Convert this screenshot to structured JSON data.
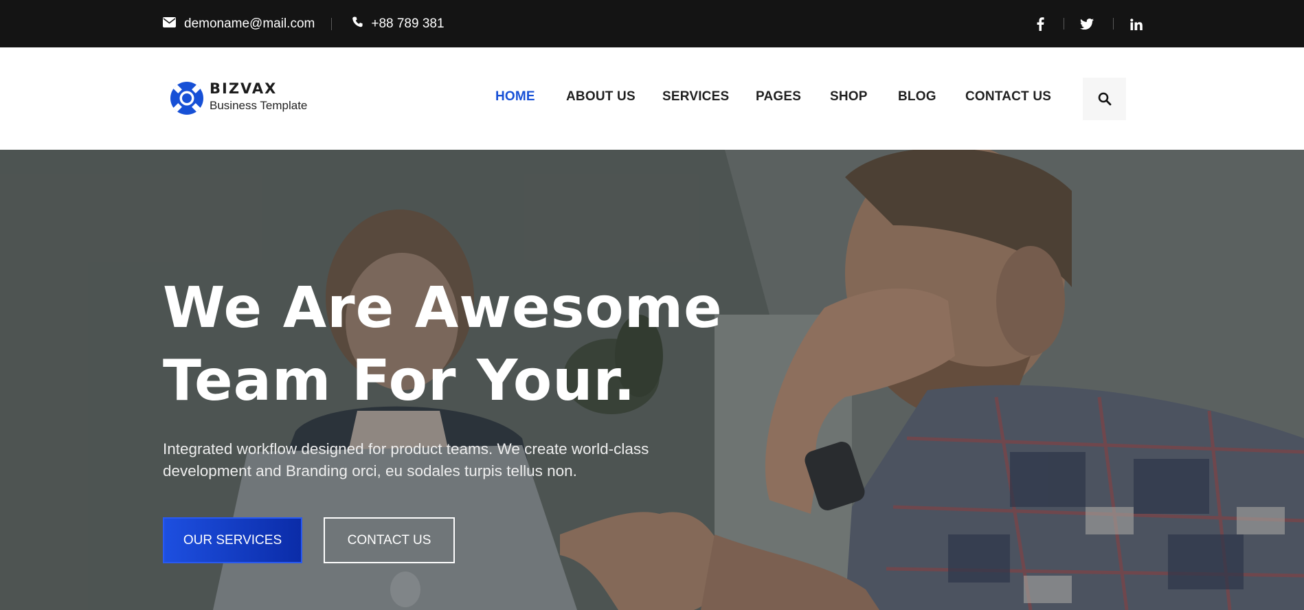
{
  "topbar": {
    "email": "demoname@mail.com",
    "phone": "+88 789 381",
    "email_icon": "envelope-icon",
    "phone_icon": "phone-icon",
    "social": [
      "facebook-icon",
      "twitter-icon",
      "linkedin-icon"
    ]
  },
  "header": {
    "logo_name": "BIZVAX",
    "logo_tagline": "Business Template",
    "nav": [
      "HOME",
      "ABOUT US",
      "SERVICES",
      "PAGES",
      "SHOP",
      "BLOG",
      "CONTACT US"
    ],
    "active_nav": "HOME",
    "search_icon": "search-icon"
  },
  "hero": {
    "title_line1": "We Are Awesome",
    "title_line2": "Team For Your.",
    "subtitle": "Integrated workflow designed for product teams. We create world-class development and Branding orci, eu sodales turpis tellus non.",
    "primary_button": "OUR SERVICES",
    "secondary_button": "CONTACT US"
  },
  "colors": {
    "accent": "#1750d6",
    "topbar_bg": "#141414",
    "button_gradient_start": "#1d4fe0",
    "button_gradient_end": "#0b2ca8"
  }
}
